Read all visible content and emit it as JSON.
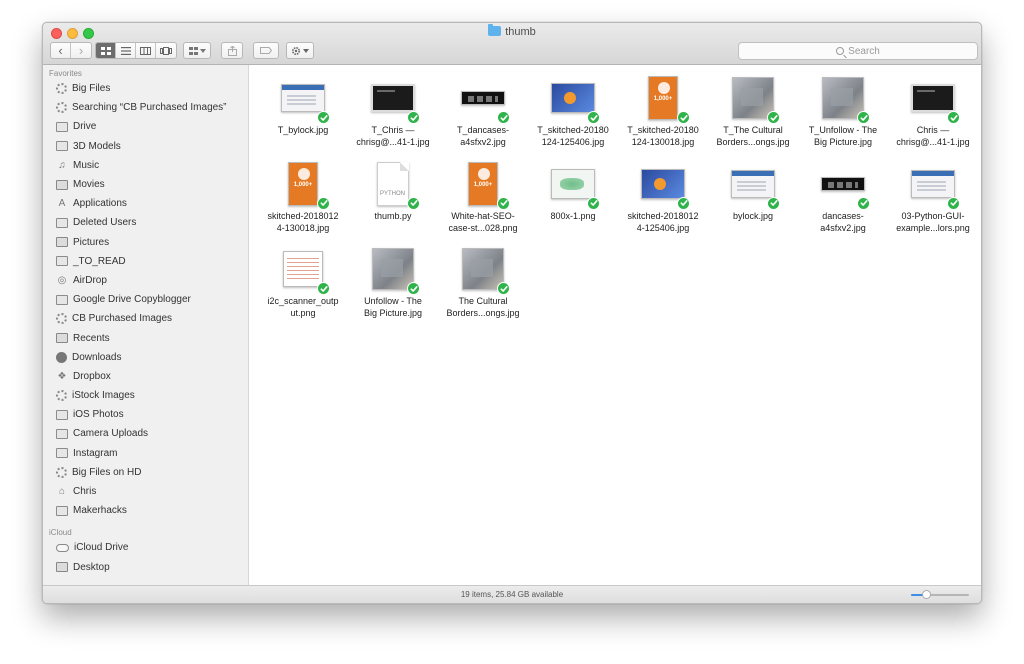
{
  "window": {
    "title": "thumb"
  },
  "toolbar": {
    "back_glyph": "‹",
    "forward_glyph": "›",
    "view_modes": [
      "icon-view",
      "list-view",
      "column-view",
      "cover-flow-view"
    ],
    "active_view": "icon-view",
    "search_placeholder": "Search"
  },
  "sidebar": {
    "sections": [
      {
        "title": "Favorites",
        "items": [
          {
            "label": "Big Files",
            "icon": "gear-icon"
          },
          {
            "label": "Searching “CB Purchased Images”",
            "icon": "gear-icon"
          },
          {
            "label": "Drive",
            "icon": "folder-icon"
          },
          {
            "label": "3D Models",
            "icon": "folder-icon"
          },
          {
            "label": "Music",
            "icon": "music-note-icon"
          },
          {
            "label": "Movies",
            "icon": "film-icon"
          },
          {
            "label": "Applications",
            "icon": "applications-icon"
          },
          {
            "label": "Deleted Users",
            "icon": "folder-icon"
          },
          {
            "label": "Pictures",
            "icon": "camera-icon"
          },
          {
            "label": "_TO_READ",
            "icon": "folder-icon"
          },
          {
            "label": "AirDrop",
            "icon": "airdrop-icon"
          },
          {
            "label": "Google Drive Copyblogger",
            "icon": "folder-icon"
          },
          {
            "label": "CB Purchased Images",
            "icon": "gear-icon"
          },
          {
            "label": "Recents",
            "icon": "recents-icon"
          },
          {
            "label": "Downloads",
            "icon": "download-icon"
          },
          {
            "label": "Dropbox",
            "icon": "dropbox-icon"
          },
          {
            "label": "iStock Images",
            "icon": "gear-icon"
          },
          {
            "label": "iOS Photos",
            "icon": "folder-icon"
          },
          {
            "label": "Camera Uploads",
            "icon": "folder-icon"
          },
          {
            "label": "Instagram",
            "icon": "folder-icon"
          },
          {
            "label": "Big Files on HD",
            "icon": "gear-icon"
          },
          {
            "label": "Chris",
            "icon": "home-icon"
          },
          {
            "label": "Makerhacks",
            "icon": "folder-icon"
          }
        ]
      },
      {
        "title": "iCloud",
        "items": [
          {
            "label": "iCloud Drive",
            "icon": "cloud-icon"
          },
          {
            "label": "Desktop",
            "icon": "desktop-icon"
          }
        ]
      }
    ]
  },
  "files": [
    {
      "line1": "T_bylock.jpg",
      "line2": "",
      "thumb": "web"
    },
    {
      "line1": "T_Chris —",
      "line2": "chrisg@...41-1.jpg",
      "thumb": "dark"
    },
    {
      "line1": "T_dancases-",
      "line2": "a4sfxv2.jpg",
      "thumb": "strip"
    },
    {
      "line1": "T_skitched-20180",
      "line2": "124-125406.jpg",
      "thumb": "blue"
    },
    {
      "line1": "T_skitched-20180",
      "line2": "124-130018.jpg",
      "thumb": "orange"
    },
    {
      "line1": "T_The Cultural",
      "line2": "Borders...ongs.jpg",
      "thumb": "photo"
    },
    {
      "line1": "T_Unfollow - The",
      "line2": "Big Picture.jpg",
      "thumb": "photo"
    },
    {
      "line1": "Chris —",
      "line2": "chrisg@...41-1.jpg",
      "thumb": "dark"
    },
    {
      "line1": "skitched-2018012",
      "line2": "4-130018.jpg",
      "thumb": "orange"
    },
    {
      "line1": "thumb.py",
      "line2": "",
      "thumb": "doc"
    },
    {
      "line1": "White-hat-SEO-",
      "line2": "case-st...028.png",
      "thumb": "orange"
    },
    {
      "line1": "800x-1.png",
      "line2": "",
      "thumb": "map"
    },
    {
      "line1": "skitched-2018012",
      "line2": "4-125406.jpg",
      "thumb": "blue"
    },
    {
      "line1": "bylock.jpg",
      "line2": "",
      "thumb": "web"
    },
    {
      "line1": "dancases-",
      "line2": "a4sfxv2.jpg",
      "thumb": "strip"
    },
    {
      "line1": "03-Python-GUI-",
      "line2": "example...lors.png",
      "thumb": "web"
    },
    {
      "line1": "i2c_scanner_outp",
      "line2": "ut.png",
      "thumb": "table"
    },
    {
      "line1": "Unfollow - The",
      "line2": "Big Picture.jpg",
      "thumb": "photo"
    },
    {
      "line1": "The Cultural",
      "line2": "Borders...ongs.jpg",
      "thumb": "photo"
    }
  ],
  "status": {
    "text": "19 items, 25.84 GB available",
    "zoom_fraction": 0.25
  },
  "colors": {
    "sync_badge": "#2fb34a",
    "folder_blue": "#5fb3ec",
    "slider_accent": "#3d8ee6"
  }
}
